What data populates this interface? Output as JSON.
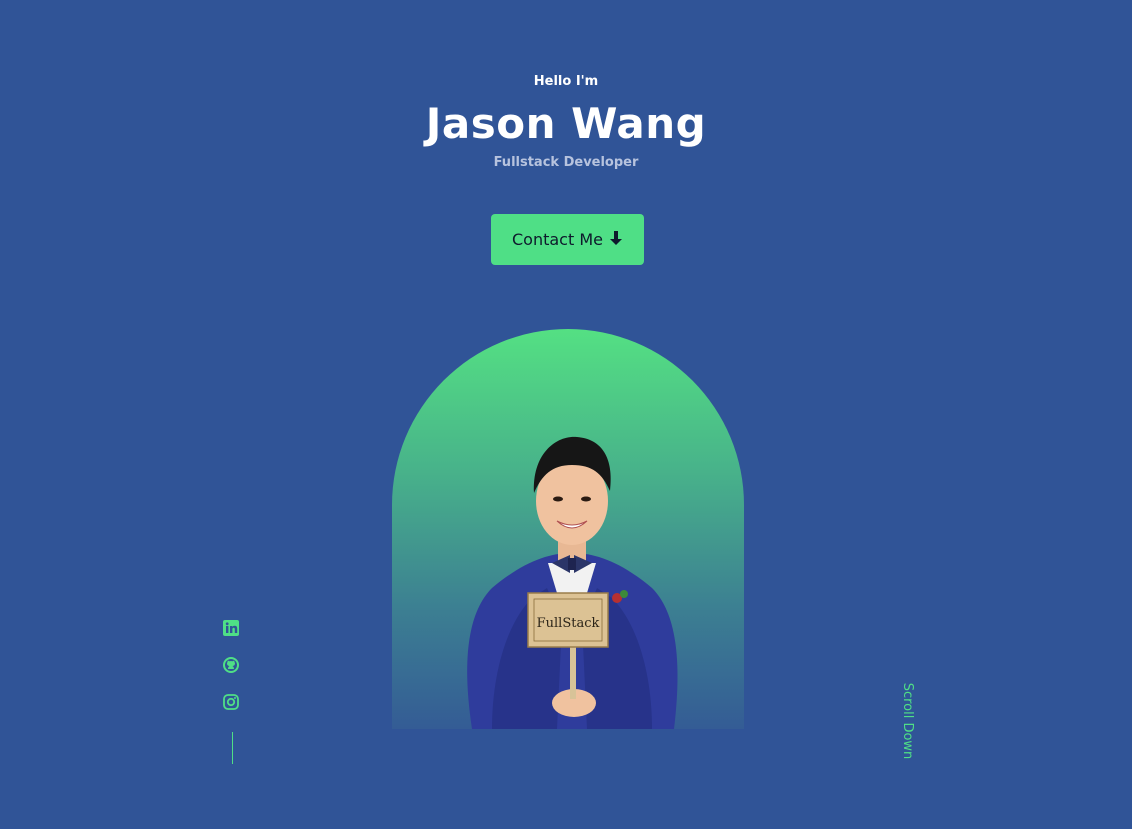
{
  "header": {
    "greeting": "Hello I'm",
    "name": "Jason Wang",
    "role": "Fullstack Developer"
  },
  "cta": {
    "label": "Contact Me",
    "icon": "arrow-down-icon"
  },
  "portrait": {
    "sign_text": "FullStack"
  },
  "socials": [
    {
      "name": "linkedin",
      "icon": "linkedin-icon"
    },
    {
      "name": "github",
      "icon": "github-icon"
    },
    {
      "name": "instagram",
      "icon": "instagram-icon"
    }
  ],
  "scroll": {
    "label": "Scroll Down"
  },
  "colors": {
    "background": "#305497",
    "accent": "#4fdf86",
    "text": "#ffffff",
    "muted": "#b7c3de"
  }
}
